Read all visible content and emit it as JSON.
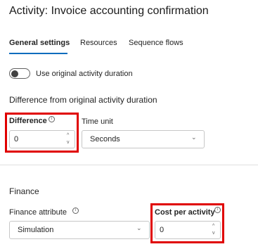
{
  "header": {
    "title": "Activity: Invoice accounting confirmation"
  },
  "tabs": [
    {
      "label": "General settings"
    },
    {
      "label": "Resources"
    },
    {
      "label": "Sequence flows"
    }
  ],
  "toggle": {
    "label": "Use original activity duration",
    "on": false
  },
  "duration_section": {
    "title": "Difference from original activity duration",
    "difference": {
      "label": "Difference",
      "value": "0"
    },
    "time_unit": {
      "label": "Time unit",
      "value": "Seconds"
    }
  },
  "finance_section": {
    "title": "Finance",
    "finance_attribute": {
      "label": "Finance attribute",
      "value": "Simulation"
    },
    "cost_per_activity": {
      "label": "Cost per activity",
      "value": "0"
    }
  },
  "icons": {
    "info": "info-icon",
    "spin_up": "chevron-up-icon",
    "spin_down": "chevron-down-icon",
    "dropdown": "chevron-down-icon",
    "info_glyph": "i",
    "up_glyph": "^",
    "down_glyph": "v",
    "chevron_glyph": "⌄"
  },
  "colors": {
    "accent": "#0f6cbd",
    "highlight": "#e00000"
  }
}
